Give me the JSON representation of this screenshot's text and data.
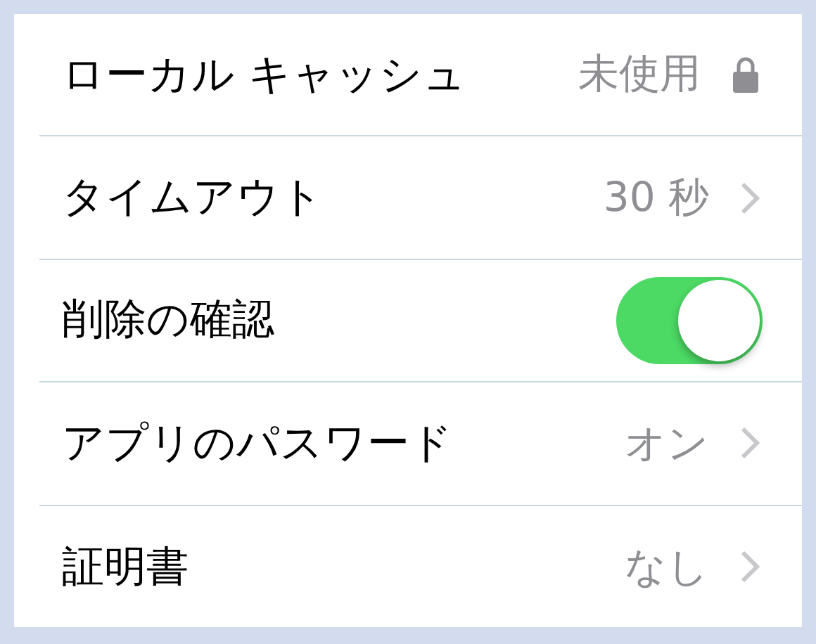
{
  "rows": [
    {
      "kind": "lock",
      "label": "ローカル キャッシュ",
      "value": "未使用"
    },
    {
      "kind": "link",
      "label": "タイムアウト",
      "value": "30 秒"
    },
    {
      "kind": "toggle",
      "label": "削除の確認",
      "on": true
    },
    {
      "kind": "link",
      "label": "アプリのパスワード",
      "value": "オン"
    },
    {
      "kind": "link",
      "label": "証明書",
      "value": "なし"
    }
  ]
}
